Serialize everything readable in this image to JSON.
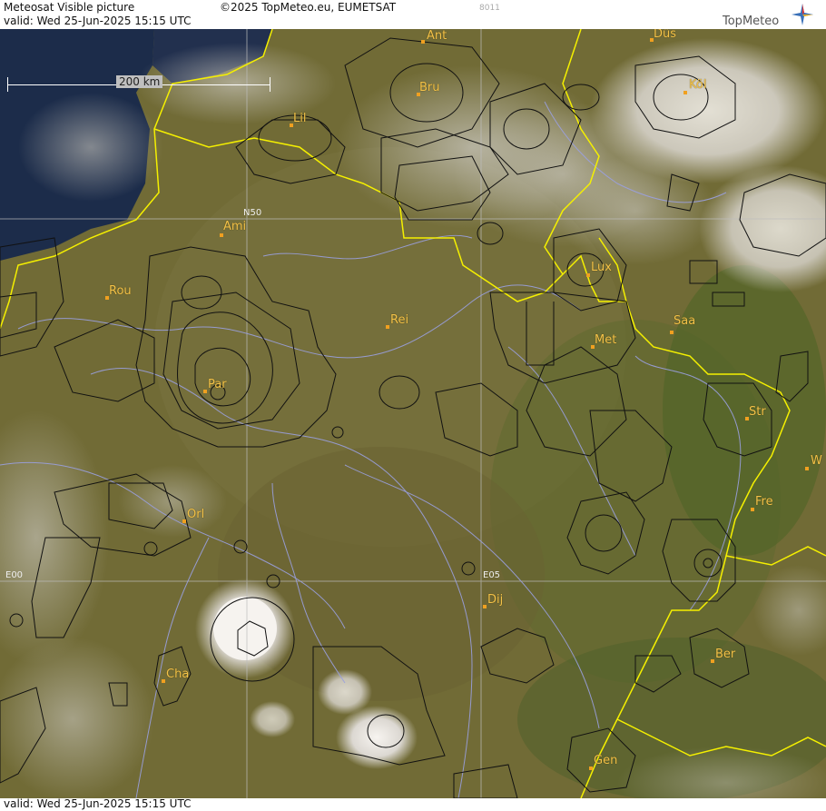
{
  "header": {
    "title": "Meteosat Visible picture",
    "valid": "valid:  Wed  25-Jun-2025  15:15 UTC",
    "copyright": "©2025 TopMeteo.eu, EUMETSAT",
    "code": "8011",
    "logo_text": "TopMeteo"
  },
  "footer": {
    "valid": "valid:  Wed  25-Jun-2025  15:15 UTC"
  },
  "scale": {
    "label": "200 km"
  },
  "grid_labels": {
    "n50": "N50",
    "e00": "E00",
    "e05": "E05"
  },
  "cities": [
    {
      "name": "Ant"
    },
    {
      "name": "Düs"
    },
    {
      "name": "Bru"
    },
    {
      "name": "Köl"
    },
    {
      "name": "Lil"
    },
    {
      "name": "Ami"
    },
    {
      "name": "Lux"
    },
    {
      "name": "Rou"
    },
    {
      "name": "Rei"
    },
    {
      "name": "Saa"
    },
    {
      "name": "Met"
    },
    {
      "name": "Par"
    },
    {
      "name": "Str"
    },
    {
      "name": "W"
    },
    {
      "name": "Fre"
    },
    {
      "name": "Orl"
    },
    {
      "name": "Dij"
    },
    {
      "name": "Ber"
    },
    {
      "name": "Cha"
    },
    {
      "name": "Gen"
    }
  ],
  "colors": {
    "land": "#6f6a35",
    "sea": "#1c2c4a",
    "border": "#f5f000",
    "rivers": "#9aa0e0",
    "airspace": "#111111",
    "city_label": "#f3c24a"
  }
}
